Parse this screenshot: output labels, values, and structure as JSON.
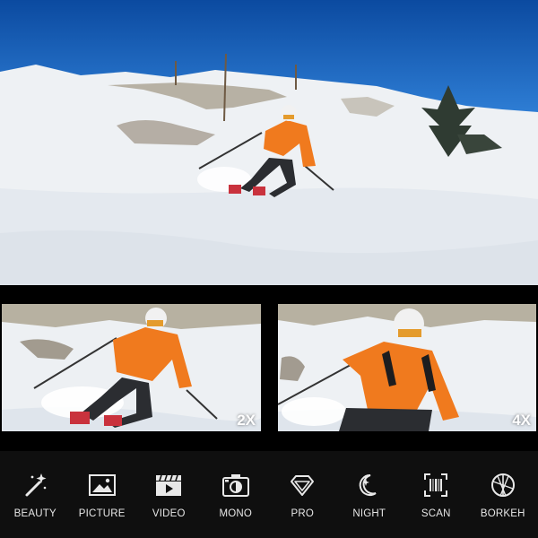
{
  "zoom_tiles": [
    {
      "label": "2X"
    },
    {
      "label": "4X"
    }
  ],
  "modes": [
    {
      "label": "BEAUTY",
      "icon": "magic-wand-icon"
    },
    {
      "label": "PICTURE",
      "icon": "image-icon"
    },
    {
      "label": "VIDEO",
      "icon": "video-clapper-icon"
    },
    {
      "label": "MONO",
      "icon": "camera-icon"
    },
    {
      "label": "PRO",
      "icon": "diamond-icon"
    },
    {
      "label": "NIGHT",
      "icon": "moon-star-icon"
    },
    {
      "label": "SCAN",
      "icon": "barcode-scan-icon"
    },
    {
      "label": "BORKEH",
      "icon": "aperture-icon"
    }
  ],
  "colors": {
    "sky": "#1a66c2",
    "snow": "#f2f4f6",
    "jacket": "#f07a1e",
    "mode_bar": "#0f0f0f",
    "label_text": "#e6e6e6"
  }
}
